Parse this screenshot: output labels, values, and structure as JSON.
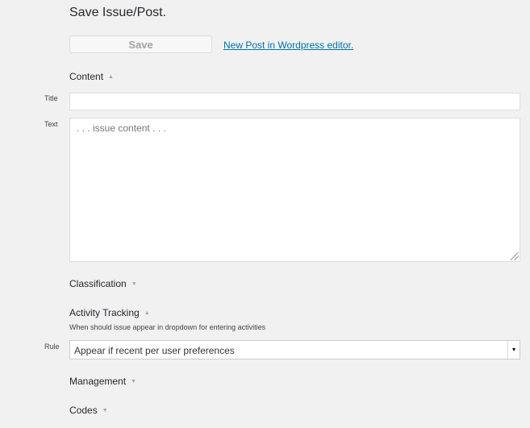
{
  "page": {
    "title": "Save Issue/Post."
  },
  "toolbar": {
    "save_label": "Save",
    "new_post_link": "New Post in Wordpress editor."
  },
  "sections": {
    "content": {
      "label": "Content",
      "arrow": "▲",
      "icon": "arrow-up-icon"
    },
    "classification": {
      "label": "Classification",
      "arrow": "▼",
      "icon": "arrow-down-icon"
    },
    "activity_tracking": {
      "label": "Activity Tracking",
      "arrow": "▲",
      "icon": "arrow-up-icon",
      "help": "When should issue appear in dropdown for entering activities"
    },
    "management": {
      "label": "Management",
      "arrow": "▼",
      "icon": "arrow-down-icon"
    },
    "codes": {
      "label": "Codes",
      "arrow": "▼",
      "icon": "arrow-down-icon"
    }
  },
  "fields": {
    "title": {
      "label": "Title",
      "value": ""
    },
    "text": {
      "label": "Text",
      "placeholder": ". . . issue content . . ."
    },
    "rule": {
      "label": "Rule",
      "value": "Appear if recent per user preferences",
      "dropdown_icon": "▾"
    }
  },
  "colors": {
    "background": "#f1f1f1",
    "link": "#0073aa",
    "button_text_disabled": "#a0a5aa",
    "arrow": "#a0a5aa"
  }
}
